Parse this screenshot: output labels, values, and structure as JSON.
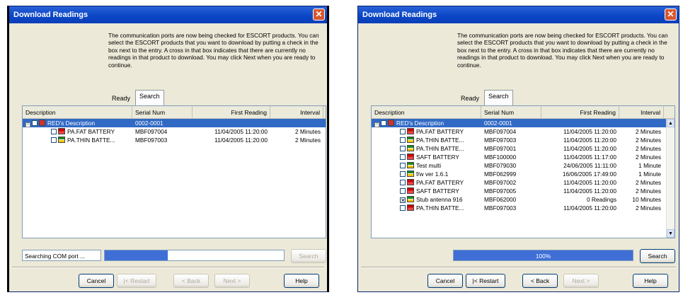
{
  "window_a": {
    "title": "Download Readings",
    "intro": "The communication ports are now being checked for ESCORT products. You can select the ESCORT products that you want to download by putting a check in the box next to the entry. A cross in that box indicates that there are currently no readings in that product to download. You may click Next when you are ready to continue.",
    "tabs": [
      "Ready",
      "Search"
    ],
    "columns": [
      "Description",
      "Serial Num",
      "First Reading",
      "Interval"
    ],
    "rows": [
      {
        "desc": "RED's Description",
        "serial": "0002-0001",
        "first": "",
        "interval": "",
        "icon": "red"
      },
      {
        "desc": "PA.FAT BATTERY",
        "serial": "MBF097004",
        "first": "11/04/2005 11:20:00",
        "interval": "2 Minutes",
        "icon": "red"
      },
      {
        "desc": "PA.THIN BATTE...",
        "serial": "MBF097003",
        "first": "11/04/2005 11:20:00",
        "interval": "2 Minutes",
        "icon": "green"
      }
    ],
    "status_text": "Searching COM port ...",
    "progress_pct": 35,
    "progress_label": "35%",
    "search_label": "Search",
    "buttons": {
      "cancel": "Cancel",
      "restart": "|< Restart",
      "back": "< Back",
      "next": "Next >",
      "help": "Help"
    }
  },
  "window_b": {
    "title": "Download Readings",
    "intro": "The communication ports are now being checked for ESCORT products. You can select the ESCORT products that you want to download by putting a check in the box next to the entry. A cross in that box indicates that there are currently no readings in that product to download. You may click Next when you are ready to continue.",
    "tabs": [
      "Ready",
      "Search"
    ],
    "columns": [
      "Description",
      "Serial Num",
      "First Reading",
      "Interval"
    ],
    "rows": [
      {
        "desc": "RED's Description",
        "serial": "0002-0001",
        "first": "",
        "interval": "",
        "icon": "red"
      },
      {
        "desc": "PA.FAT BATTERY",
        "serial": "MBF097004",
        "first": "11/04/2005 11:20:00",
        "interval": "2 Minutes",
        "icon": "red"
      },
      {
        "desc": "PA.THIN BATTE...",
        "serial": "MBF097003",
        "first": "11/04/2005 11:20:00",
        "interval": "2 Minutes",
        "icon": "green"
      },
      {
        "desc": "PA.THIN BATTE...",
        "serial": "MBF097001",
        "first": "11/04/2005 11:20:00",
        "interval": "2 Minutes",
        "icon": "green"
      },
      {
        "desc": "SAFT BATTERY",
        "serial": "MBF100000",
        "first": "11/04/2005 11:17:00",
        "interval": "2 Minutes",
        "icon": "red"
      },
      {
        "desc": "Test multi",
        "serial": "MBF079030",
        "first": "24/06/2005 11:11:00",
        "interval": "1 Minute",
        "icon": "green"
      },
      {
        "desc": "f/w ver 1.6.1",
        "serial": "MBF062999",
        "first": "16/06/2005 17:49:00",
        "interval": "1 Minute",
        "icon": "green"
      },
      {
        "desc": "PA.FAT BATTERY",
        "serial": "MBF097002",
        "first": "11/04/2005 11:20:00",
        "interval": "2 Minutes",
        "icon": "red"
      },
      {
        "desc": "SAFT BATTERY",
        "serial": "MBF097005",
        "first": "11/04/2005 11:20:00",
        "interval": "2 Minutes",
        "icon": "red"
      },
      {
        "desc": "Stub antenna 916",
        "serial": "MBF062000",
        "first": "0 Readings",
        "interval": "10 Minutes",
        "icon": "green",
        "crossed": true
      },
      {
        "desc": "PA.THIN BATTE...",
        "serial": "MBF097003",
        "first": "11/04/2005 11:20:00",
        "interval": "2 Minutes",
        "icon": "red"
      }
    ],
    "progress_pct": 100,
    "progress_label": "100%",
    "search_label": "Search",
    "buttons": {
      "cancel": "Cancel",
      "restart": "|< Restart",
      "back": "< Back",
      "next": "Next >",
      "help": "Help"
    }
  }
}
